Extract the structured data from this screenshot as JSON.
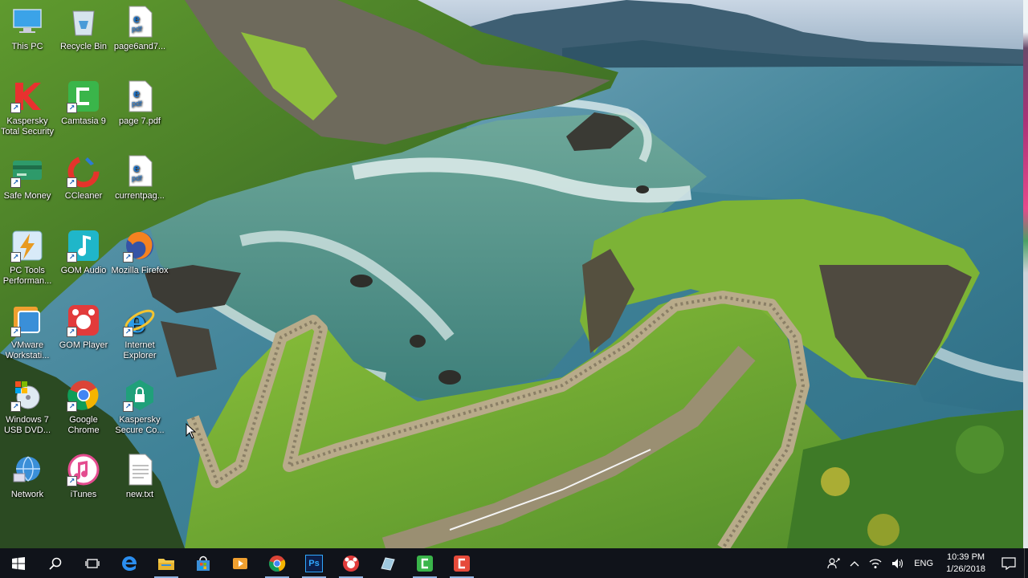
{
  "desktop": {
    "icons": [
      {
        "label": "This PC",
        "icon": "this-pc-icon"
      },
      {
        "label": "Recycle Bin",
        "icon": "recycle-bin-icon"
      },
      {
        "label": "page6and7...",
        "icon": "pdf-file-icon"
      },
      {
        "label": "Kaspersky Total Security",
        "icon": "kaspersky-total-security-icon"
      },
      {
        "label": "Camtasia 9",
        "icon": "camtasia-icon"
      },
      {
        "label": "page 7.pdf",
        "icon": "pdf-file-icon"
      },
      {
        "label": "Safe Money",
        "icon": "safe-money-icon"
      },
      {
        "label": "CCleaner",
        "icon": "ccleaner-icon"
      },
      {
        "label": "currentpag...",
        "icon": "pdf-file-icon"
      },
      {
        "label": "PC Tools Performan...",
        "icon": "pc-tools-icon"
      },
      {
        "label": "GOM Audio",
        "icon": "gom-audio-icon"
      },
      {
        "label": "Mozilla Firefox",
        "icon": "firefox-icon"
      },
      {
        "label": "VMware Workstati...",
        "icon": "vmware-icon"
      },
      {
        "label": "GOM Player",
        "icon": "gom-player-icon"
      },
      {
        "label": "Internet Explorer",
        "icon": "internet-explorer-icon"
      },
      {
        "label": "Windows 7 USB DVD...",
        "icon": "windows-usb-dvd-icon"
      },
      {
        "label": "Google Chrome",
        "icon": "chrome-icon"
      },
      {
        "label": "Kaspersky Secure Co...",
        "icon": "kaspersky-secure-connection-icon"
      },
      {
        "label": "Network",
        "icon": "network-icon"
      },
      {
        "label": "iTunes",
        "icon": "itunes-icon"
      },
      {
        "label": "new.txt",
        "icon": "text-file-icon"
      }
    ]
  },
  "taskbar": {
    "buttons": [
      {
        "icon": "windows-start-icon"
      },
      {
        "icon": "search-icon"
      },
      {
        "icon": "task-view-icon"
      },
      {
        "icon": "edge-icon"
      },
      {
        "icon": "file-explorer-icon"
      },
      {
        "icon": "store-icon"
      },
      {
        "icon": "media-player-icon"
      },
      {
        "icon": "chrome-icon"
      },
      {
        "icon": "photoshop-icon",
        "text": "Ps"
      },
      {
        "icon": "gom-player-icon"
      },
      {
        "icon": "app-icon"
      },
      {
        "icon": "camtasia-icon"
      },
      {
        "icon": "camtasia-recorder-icon"
      }
    ],
    "tray": {
      "language": "ENG",
      "time": "10:39 PM",
      "date": "1/26/2018"
    }
  },
  "colors": {
    "taskbar": "#10131a",
    "accent": "#1a73e8"
  }
}
